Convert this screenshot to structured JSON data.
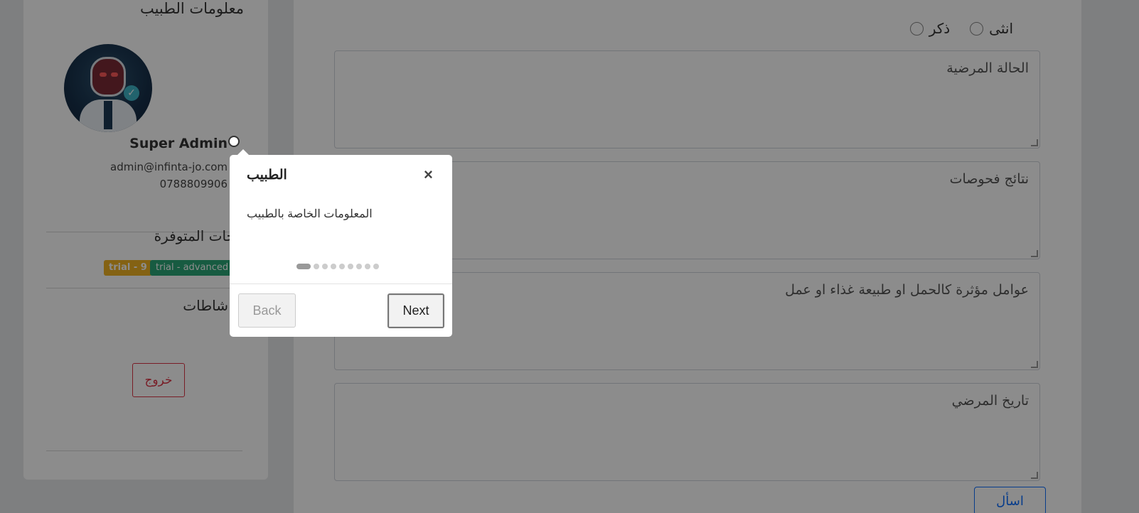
{
  "sidebar": {
    "title": "معلومات الطبيب",
    "name": "Super Admin",
    "email": "admin@infinta-jo.com",
    "phone": "0788809906",
    "packages_heading": "كجات المتوفرة",
    "badge_trial": "trial - 9",
    "badge_advanced": "trial - advanced -",
    "activities_heading": "شاطات",
    "logout_label": "خروج"
  },
  "main": {
    "gender_options": [
      "انثى",
      "ذكر"
    ],
    "fields": [
      {
        "placeholder": "الحالة المرضية"
      },
      {
        "placeholder": "نتائج فحوصات"
      },
      {
        "placeholder": "عوامل مؤثرة كالحمل او طبيعة غذاء او عمل"
      },
      {
        "placeholder": "تاريخ المرضي"
      }
    ],
    "ask_button": "اسأل"
  },
  "tour": {
    "title": "الطبيب",
    "description": "المعلومات الخاصة بالطبيب",
    "close_symbol": "×",
    "back_label": "Back",
    "next_label": "Next",
    "step_count": 9,
    "current_step": 1
  }
}
